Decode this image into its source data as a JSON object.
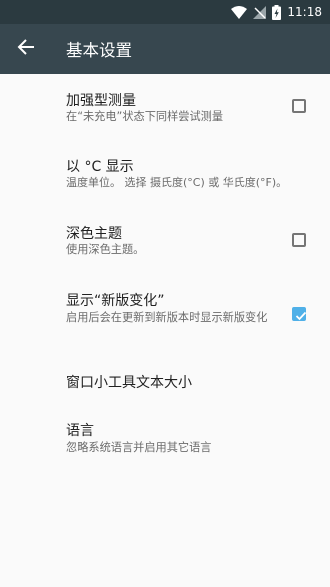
{
  "status": {
    "time": "11:18",
    "icons": [
      "wifi-icon",
      "no-signal-icon",
      "battery-charging-icon"
    ]
  },
  "appbar": {
    "title": "基本设置",
    "back_icon": "arrow-back-icon"
  },
  "settings": [
    {
      "title": "加强型测量",
      "subtitle": "在“未充电”状态下同样尝试测量",
      "checkbox": true,
      "checked": false
    },
    {
      "title": "以 °C 显示",
      "subtitle": "温度单位。 选择 摄氏度(°C) 或 华氏度(°F)。",
      "checkbox": false
    },
    {
      "title": "深色主题",
      "subtitle": "使用深色主题。",
      "checkbox": true,
      "checked": false
    },
    {
      "title": "显示“新版变化”",
      "subtitle": "启用后会在更新到新版本时显示新版变化",
      "checkbox": true,
      "checked": true
    },
    {
      "title": "窗口小工具文本大小",
      "subtitle": "",
      "checkbox": false
    },
    {
      "title": "语言",
      "subtitle": "忽略系统语言并启用其它语言",
      "checkbox": false
    }
  ],
  "colors": {
    "appbar": "#37474f",
    "statusbar": "#2b3a40",
    "accent": "#4fb0e8"
  }
}
